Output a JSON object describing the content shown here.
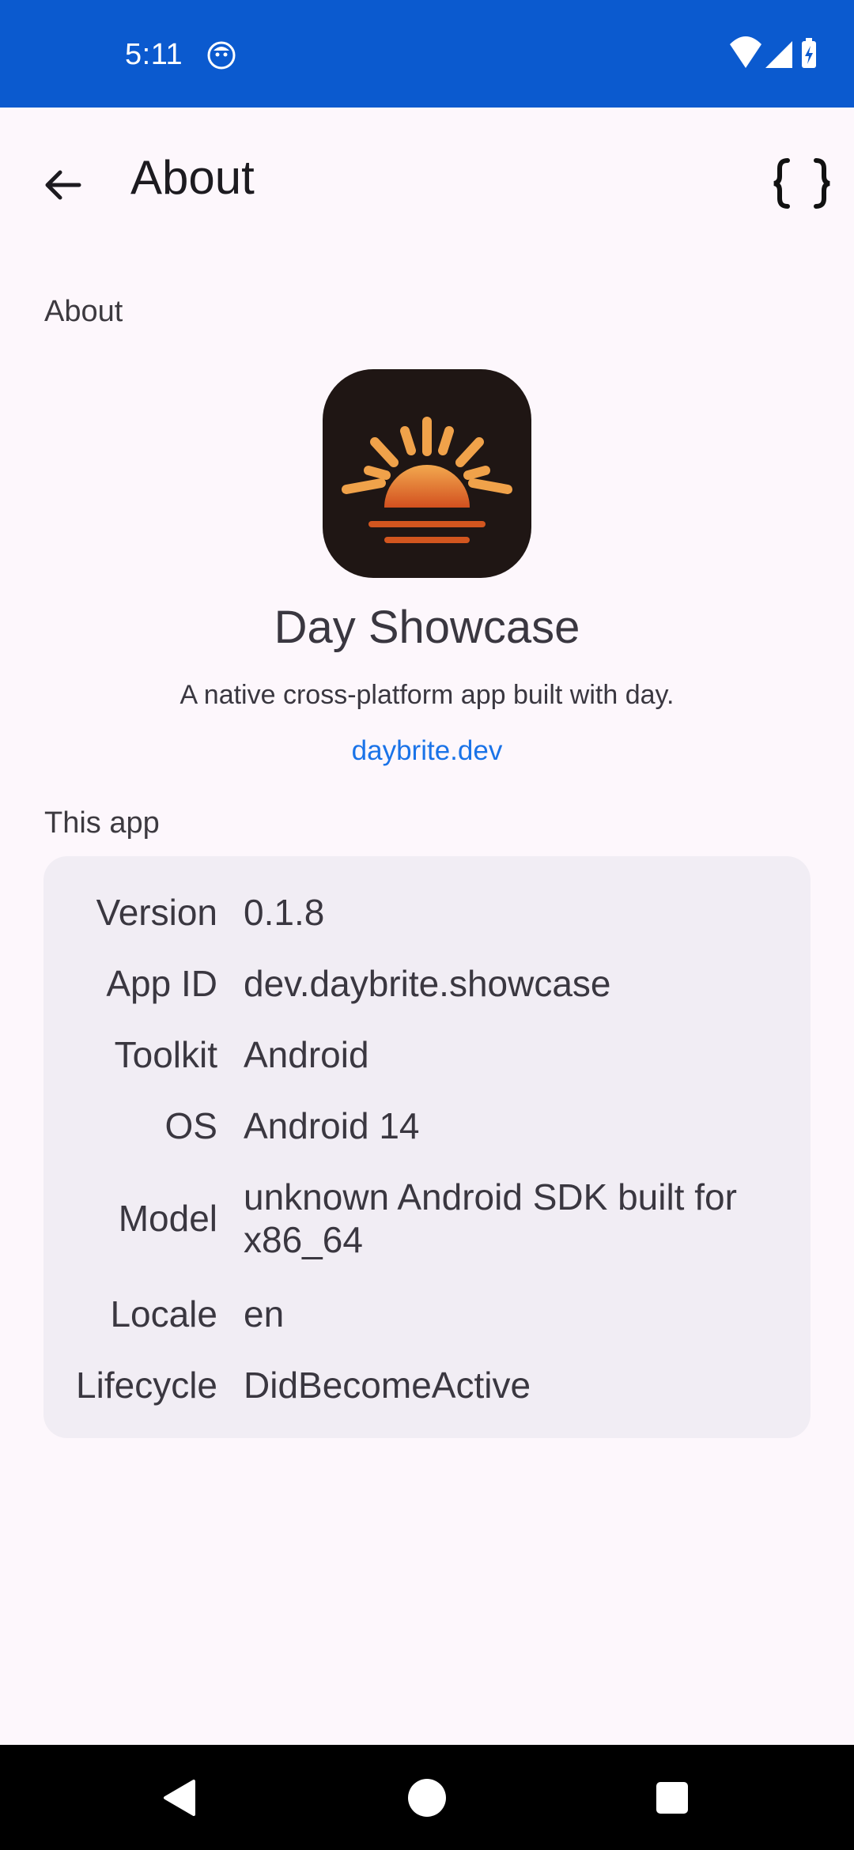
{
  "status_bar": {
    "time": "5:11",
    "icons": [
      "face-notification-icon",
      "wifi-icon",
      "signal-icon",
      "battery-charging-icon"
    ],
    "color": "#0b5acf"
  },
  "app_bar": {
    "title": "About",
    "back_icon": "arrow-left-icon",
    "action_icon": "braces-icon"
  },
  "about_section": {
    "label": "About",
    "app_name": "Day Showcase",
    "description": "A native cross-platform app built with day.",
    "link": "daybrite.dev"
  },
  "this_app": {
    "label": "This app",
    "rows": [
      {
        "key": "Version",
        "value": "0.1.8"
      },
      {
        "key": "App ID",
        "value": "dev.daybrite.showcase"
      },
      {
        "key": "Toolkit",
        "value": "Android"
      },
      {
        "key": "OS",
        "value": "Android 14"
      },
      {
        "key": "Model",
        "value": "unknown Android SDK built for x86_64"
      },
      {
        "key": "Locale",
        "value": "en"
      },
      {
        "key": "Lifecycle",
        "value": "DidBecomeActive"
      }
    ]
  },
  "nav_bar": {
    "icons": [
      "back-triangle-icon",
      "home-circle-icon",
      "recents-square-icon"
    ]
  },
  "colors": {
    "background": "#fdf7fc",
    "card": "#f1edf4",
    "link": "#1a73e8",
    "icon_bg": "#1f1614",
    "sun_orange": "#f0a24a"
  }
}
